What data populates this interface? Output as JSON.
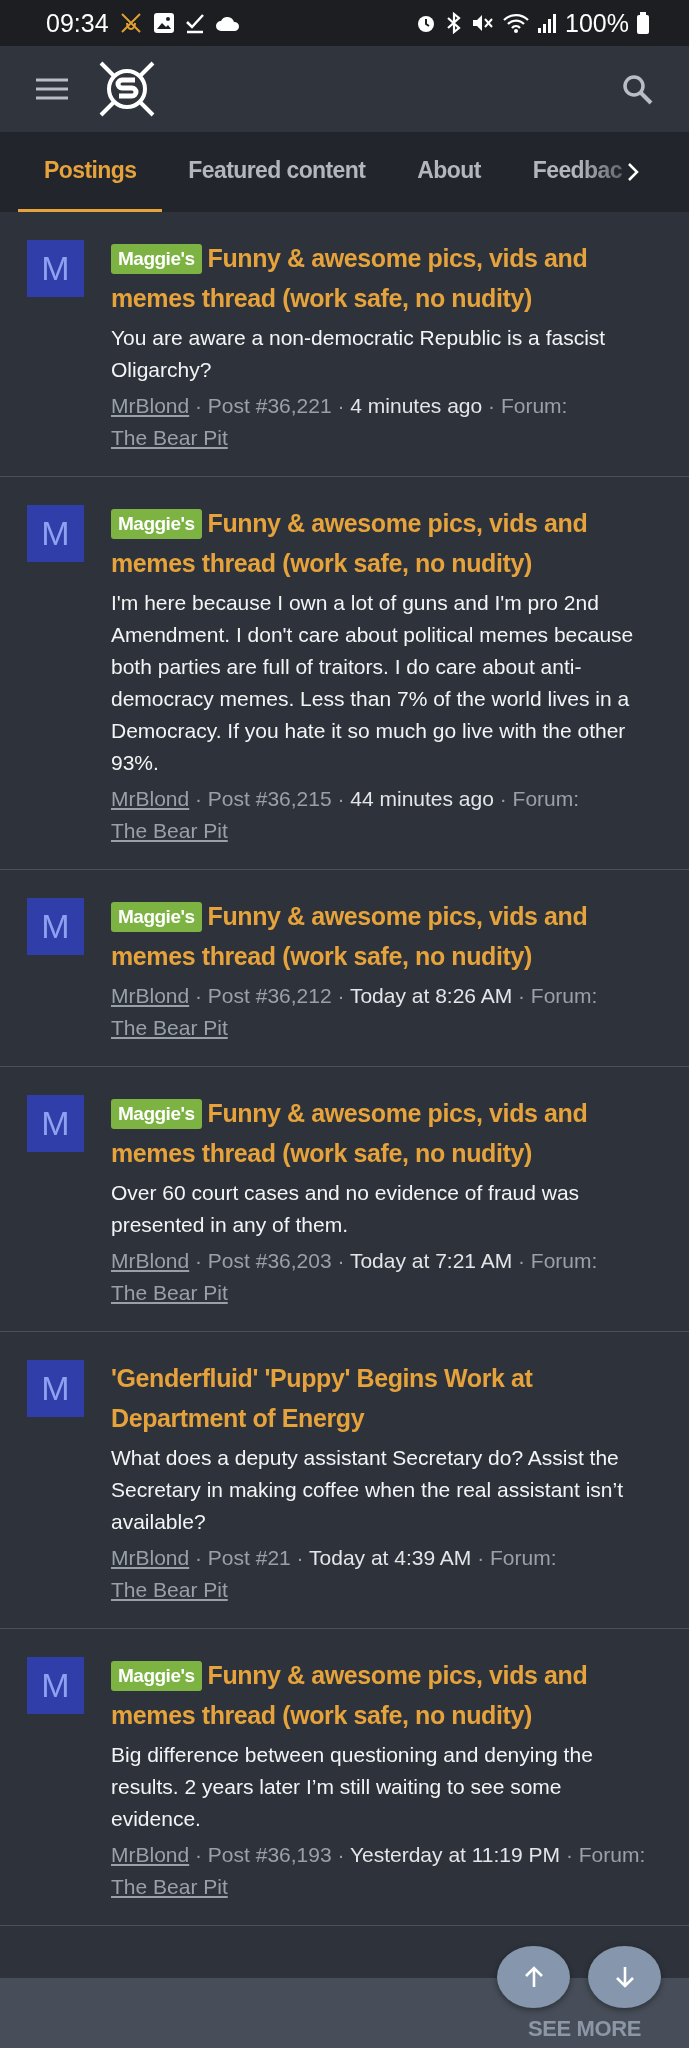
{
  "status_bar": {
    "time": "09:34",
    "battery": "100%"
  },
  "tabs": [
    {
      "label": "Postings",
      "selected": true
    },
    {
      "label": "Featured content",
      "selected": false
    },
    {
      "label": "About",
      "selected": false
    },
    {
      "label": "Feedbac",
      "selected": false
    }
  ],
  "posts": [
    {
      "avatar": "M",
      "prefix": "Maggie's",
      "title": "Funny & awesome pics, vids and memes thread (work safe, no nudity)",
      "snippet": "You are aware a non-democratic Republic is a fascist Oligarchy?",
      "author": "MrBlond",
      "post": "· Post #36,221 ·",
      "time": "4 minutes ago",
      "forum_label": "· Forum:",
      "forum": "The Bear Pit"
    },
    {
      "avatar": "M",
      "prefix": "Maggie's",
      "title": "Funny & awesome pics, vids and memes thread (work safe, no nudity)",
      "snippet": "I'm here because I own a lot of guns and I'm pro 2nd Amendment. I don't care about political memes because both parties are full of traitors. I do care about anti-democracy memes. Less than 7% of the world lives in a Democracy. If you hate it so much go live with the other 93%.",
      "author": "MrBlond",
      "post": "· Post #36,215 ·",
      "time": "44 minutes ago",
      "forum_label": "· Forum:",
      "forum": "The Bear Pit"
    },
    {
      "avatar": "M",
      "prefix": "Maggie's",
      "title": "Funny & awesome pics, vids and memes thread (work safe, no nudity)",
      "author": "MrBlond",
      "post": "· Post #36,212 ·",
      "time": "Today at 8:26 AM",
      "forum_label": "· Forum:",
      "forum": "The Bear Pit"
    },
    {
      "avatar": "M",
      "prefix": "Maggie's",
      "title": "Funny & awesome pics, vids and memes thread (work safe, no nudity)",
      "snippet": "Over 60 court cases and no evidence of fraud was presented in any of them.",
      "author": "MrBlond",
      "post": "· Post #36,203 ·",
      "time": "Today at 7:21 AM",
      "forum_label": "· Forum:",
      "forum": "The Bear Pit"
    },
    {
      "avatar": "M",
      "title": "'Genderfluid' 'Puppy' Begins Work at Department of Energy",
      "snippet": "What does a deputy assistant Secretary do? Assist the Secretary in making coffee when the real assistant isn’t available?",
      "author": "MrBlond",
      "post": "· Post #21 ·",
      "time": "Today at 4:39 AM",
      "forum_label": "· Forum:",
      "forum": "The Bear Pit"
    },
    {
      "avatar": "M",
      "prefix": "Maggie's",
      "title": "Funny & awesome pics, vids and memes thread (work safe, no nudity)",
      "snippet": "Big difference between questioning and denying the results. 2 years later I’m still waiting to see some evidence.",
      "author": "MrBlond",
      "post": "· Post #36,193 ·",
      "time": "Yesterday at 11:19 PM",
      "forum_label": "· Forum:",
      "forum": "The Bear Pit"
    }
  ],
  "see_more": "SEE MORE"
}
